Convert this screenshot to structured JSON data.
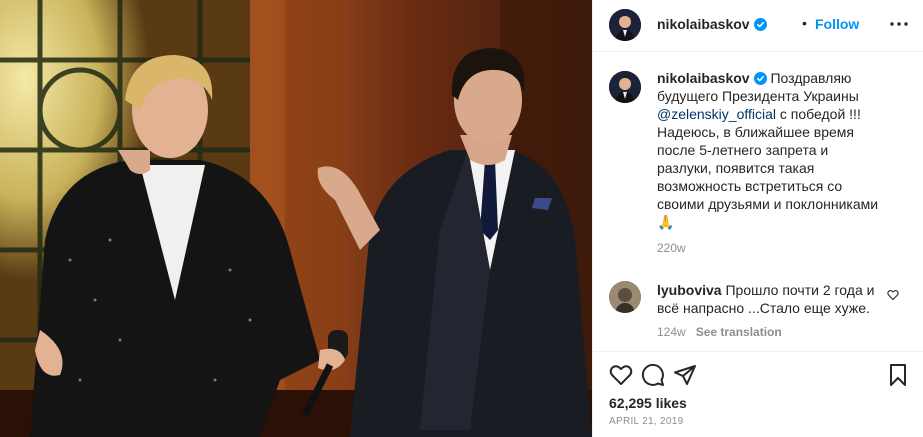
{
  "header": {
    "username": "nikolaibaskov",
    "dot": "•",
    "follow_label": "Follow",
    "more_icon": "more-horizontal-icon"
  },
  "caption": {
    "username": "nikolaibaskov",
    "lines": [
      "Поздравляю",
      "будущего Президента Украины",
      "с победой !!!",
      "Надеюсь, в ближайшее время",
      "после 5-летнего запрета и",
      "разлуки, появится такая",
      "возможность встретиться со",
      "своими друзьями и поклонниками"
    ],
    "mention": "@zelenskiy_official",
    "emoji": "🙏",
    "age": "220w"
  },
  "comment": {
    "username": "lyuboviva",
    "text_1": "Прошло почти 2 года и",
    "text_2": "всё напрасно ...Стало еще хуже.",
    "age": "124w",
    "translate_label": "See translation"
  },
  "actions": {
    "like_icon": "heart-icon",
    "comment_icon": "comment-icon",
    "share_icon": "share-icon",
    "save_icon": "bookmark-icon"
  },
  "stats": {
    "likes": "62,295 likes",
    "date": "APRIL 21, 2019"
  },
  "colors": {
    "link": "#0095f6",
    "mention": "#00376b",
    "muted": "#8e8e8e",
    "verified": "#0095f6"
  }
}
